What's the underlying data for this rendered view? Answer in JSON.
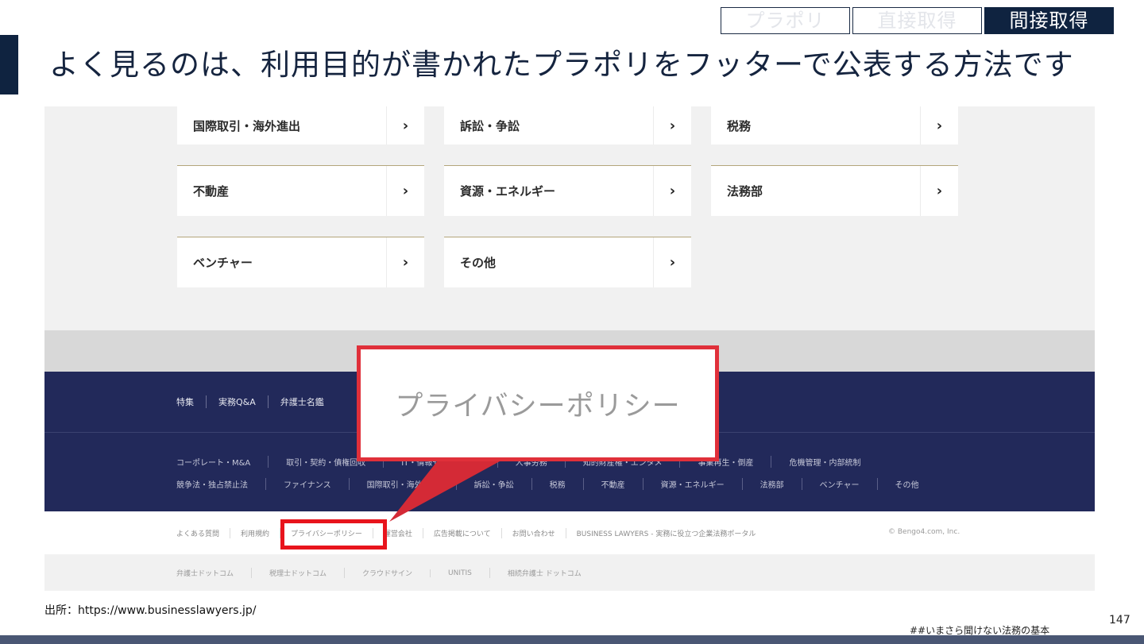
{
  "tabs": [
    {
      "label": "プラポリ",
      "active": false
    },
    {
      "label": "直接取得",
      "active": false
    },
    {
      "label": "間接取得",
      "active": true
    }
  ],
  "slide_title": "よく見るのは、利用目的が書かれたプラポリをフッターで公表する方法です",
  "categories": [
    {
      "label": "国際取引・海外進出",
      "arrow": "›"
    },
    {
      "label": "訴訟・争訟",
      "arrow": "›"
    },
    {
      "label": "税務",
      "arrow": "›"
    },
    {
      "label": "不動産",
      "arrow": "›"
    },
    {
      "label": "資源・エネルギー",
      "arrow": "›"
    },
    {
      "label": "法務部",
      "arrow": "›"
    },
    {
      "label": "ベンチャー",
      "arrow": "›"
    },
    {
      "label": "その他",
      "arrow": "›"
    }
  ],
  "footer_nav": [
    "特集",
    "実務Q&A",
    "弁護士名鑑"
  ],
  "footer_links_row1": [
    "コーポレート・M&A",
    "取引・契約・債権回収",
    "IT・情報セキュリティ",
    "人事労務",
    "知的財産権・エンタメ",
    "事業再生・倒産",
    "危機管理・内部統制"
  ],
  "footer_links_row2": [
    "競争法・独占禁止法",
    "ファイナンス",
    "国際取引・海外進出",
    "訴訟・争訟",
    "税務",
    "不動産",
    "資源・エネルギー",
    "法務部",
    "ベンチャー",
    "その他"
  ],
  "bottom_links": [
    "よくある質問",
    "利用規約",
    "プライバシーポリシー",
    "運営会社",
    "広告掲載について",
    "お問い合わせ",
    "BUSINESS LAWYERS - 実務に役立つ企業法務ポータル"
  ],
  "copyright": "© Bengo4.com, Inc.",
  "sister_sites": [
    "弁護士ドットコム",
    "税理士ドットコム",
    "クラウドサイン",
    "UNITIS",
    "相続弁護士 ドットコム"
  ],
  "callout_text": "プライバシーポリシー",
  "source": "出所：https://www.businesslawyers.jp/",
  "page_number": "147",
  "hashtag": "##いまさら聞けない法務の基本",
  "colors": {
    "navy": "#0f2340",
    "footer_navy": "#22295a",
    "callout_red": "#e0303a"
  }
}
